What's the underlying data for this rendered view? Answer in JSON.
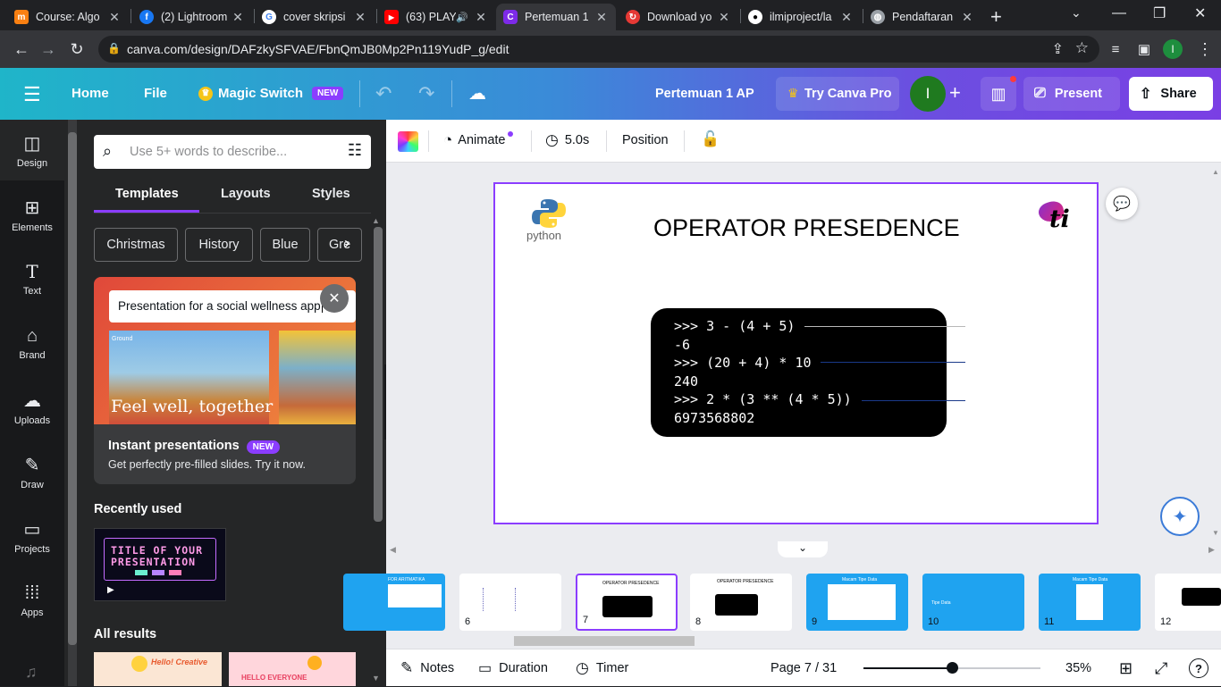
{
  "browser": {
    "tabs": [
      {
        "title": "Course: Algo",
        "icon": "moodle-icon",
        "fav": "m",
        "color": "#f98012"
      },
      {
        "title": "(2) Lightroom",
        "icon": "facebook-icon",
        "fav": "f",
        "color": "#1877f2"
      },
      {
        "title": "cover skripsi",
        "icon": "google-icon",
        "fav": "G",
        "color": "#fff"
      },
      {
        "title": "(63) PLAY",
        "icon": "youtube-icon",
        "fav": "▶",
        "color": "#ff0000"
      },
      {
        "title": "Pertemuan 1",
        "icon": "canva-icon",
        "fav": "C",
        "color": "#7d2ae8"
      },
      {
        "title": "Download yo",
        "icon": "download-site-icon",
        "fav": "●",
        "color": "#e53935"
      },
      {
        "title": "ilmiproject/la",
        "icon": "github-icon",
        "fav": "●",
        "color": "#fff"
      },
      {
        "title": "Pendaftaran",
        "icon": "globe-icon",
        "fav": "◍",
        "color": "#9aa0a6"
      }
    ],
    "url": "canva.com/design/DAFzkySFVAE/FbnQmJB0Mp2Pn119YudP_g/edit",
    "profile_initial": "I"
  },
  "header": {
    "home": "Home",
    "file": "File",
    "magic_switch": "Magic Switch",
    "new_badge": "NEW",
    "doc_title": "Pertemuan 1 AP",
    "try_pro": "Try Canva Pro",
    "avatar": "I",
    "present": "Present",
    "share": "Share"
  },
  "rail": [
    {
      "label": "Design",
      "icon": "design-icon"
    },
    {
      "label": "Elements",
      "icon": "elements-icon"
    },
    {
      "label": "Text",
      "icon": "text-icon"
    },
    {
      "label": "Brand",
      "icon": "brand-icon"
    },
    {
      "label": "Uploads",
      "icon": "uploads-icon"
    },
    {
      "label": "Draw",
      "icon": "draw-icon"
    },
    {
      "label": "Projects",
      "icon": "projects-icon"
    },
    {
      "label": "Apps",
      "icon": "apps-icon"
    }
  ],
  "panel": {
    "search_placeholder": "Use 5+ words to describe...",
    "tabs": [
      "Templates",
      "Layouts",
      "Styles"
    ],
    "chips": [
      "Christmas",
      "History",
      "Blue",
      "Gre"
    ],
    "promo_input": "Presentation for a social wellness app",
    "promo_image_caption": "Feel well, together",
    "promo_image_brand": "Ground",
    "promo_title": "Instant presentations",
    "promo_badge": "NEW",
    "promo_sub": "Get perfectly pre-filled slides. Try it now.",
    "recently_used": "Recently used",
    "recent_thumb_title_1": "TITLE OF YOUR",
    "recent_thumb_title_2": "PRESENTATION",
    "all_results": "All results",
    "result_1_text": "Hello! Creative",
    "result_2_text": "HELLO EVERYONE"
  },
  "toolbar": {
    "animate": "Animate",
    "duration": "5.0s",
    "position": "Position"
  },
  "slide": {
    "title": "OPERATOR PRESEDENCE",
    "python_logo_text": "python",
    "ti_logo_text": "ti",
    "code_lines": [
      ">>> 3 - (4 + 5)",
      "-6",
      ">>> (20 + 4) * 10",
      "240",
      ">>> 2 * (3 ** (4 * 5))",
      "6973568802"
    ]
  },
  "thumbnails": [
    {
      "num": "",
      "label": "FOR ARITMATIKA"
    },
    {
      "num": "6",
      "label": ""
    },
    {
      "num": "7",
      "label": "OPERATOR PRESEDENCE"
    },
    {
      "num": "8",
      "label": "OPERATOR PRESEDENCE"
    },
    {
      "num": "9",
      "label": "Macam Tipe Data"
    },
    {
      "num": "10",
      "label": "Tipe Data"
    },
    {
      "num": "11",
      "label": "Macam Tipe Data"
    },
    {
      "num": "12",
      "label": ""
    }
  ],
  "footer": {
    "notes": "Notes",
    "duration": "Duration",
    "timer": "Timer",
    "page": "Page 7 / 31",
    "zoom": "35%",
    "zoom_level": 0.35
  },
  "colors": {
    "accent": "#8b3dff",
    "canva_teal": "#1fb5c9",
    "avatar_green": "#1f7a1f"
  }
}
